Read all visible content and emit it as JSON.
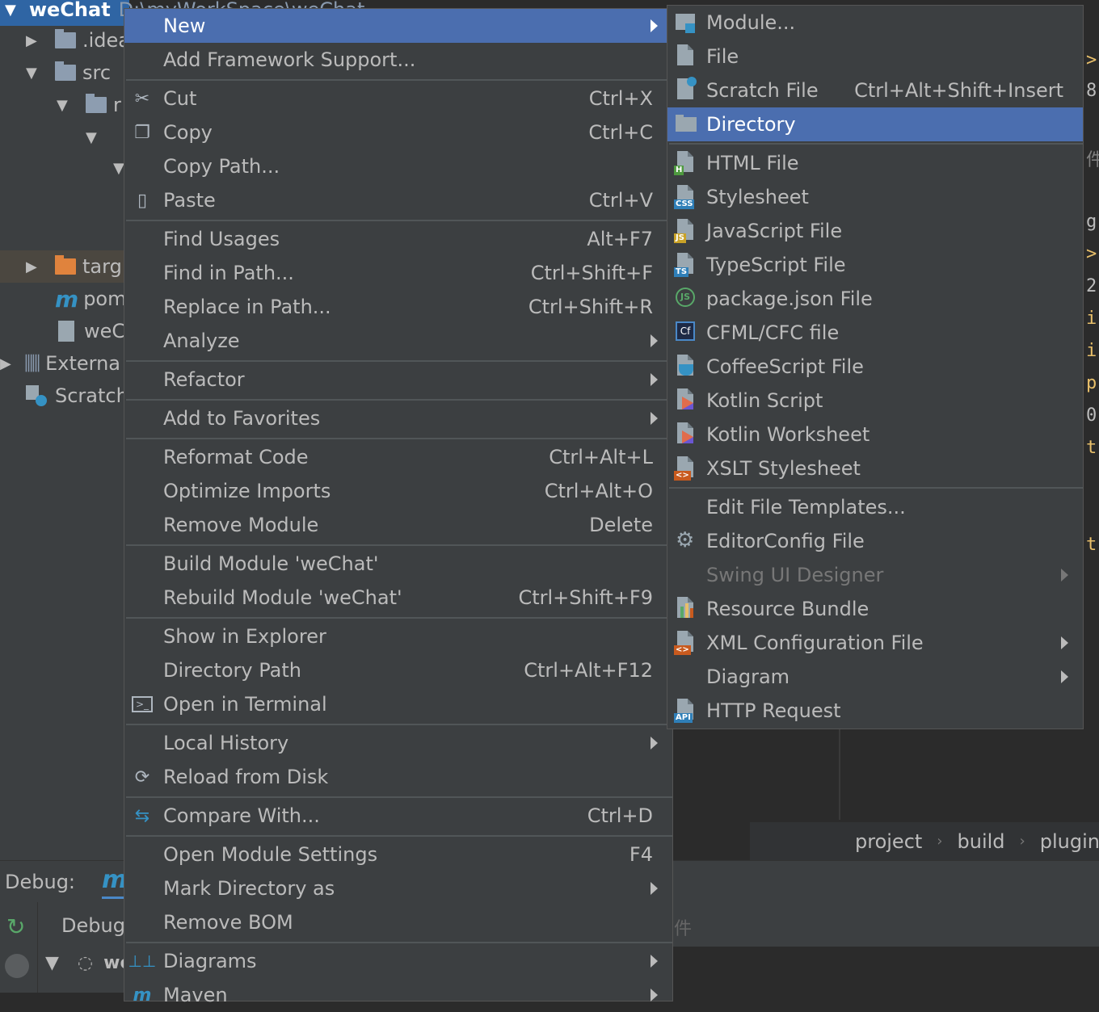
{
  "project_tree": {
    "root_name": "weChat",
    "root_path": "D:\\myWorkSpace\\weChat",
    "items": [
      {
        "label": ".idea"
      },
      {
        "label": "src"
      },
      {
        "label": "r"
      },
      {
        "label": "targ"
      },
      {
        "label": "pom"
      },
      {
        "label": "weC"
      },
      {
        "label": "Externa"
      },
      {
        "label": "Scratch"
      }
    ]
  },
  "editor": {
    "code_fragments": [
      ">",
      "8",
      "件",
      "g",
      ">",
      "2",
      "i",
      "i",
      "p",
      "0",
      "t",
      "t"
    ]
  },
  "breadcrumb": [
    "project",
    "build",
    "plugin"
  ],
  "debug": {
    "label": "Debug:",
    "config_icon": "m",
    "tab": "Debugg",
    "tree_label": "we",
    "side_text": "件"
  },
  "context_menu": {
    "items": [
      {
        "label": "New",
        "shortcut": "",
        "submenu": true,
        "icon": ""
      },
      {
        "label": "Add Framework Support...",
        "shortcut": "",
        "submenu": false,
        "icon": ""
      },
      {
        "label": "Cut",
        "shortcut": "Ctrl+X",
        "submenu": false,
        "icon": "scissors-icon"
      },
      {
        "label": "Copy",
        "shortcut": "Ctrl+C",
        "submenu": false,
        "icon": "copy-icon"
      },
      {
        "label": "Copy Path...",
        "shortcut": "",
        "submenu": false,
        "icon": ""
      },
      {
        "label": "Paste",
        "shortcut": "Ctrl+V",
        "submenu": false,
        "icon": "paste-icon"
      },
      {
        "label": "Find Usages",
        "shortcut": "Alt+F7",
        "submenu": false,
        "icon": ""
      },
      {
        "label": "Find in Path...",
        "shortcut": "Ctrl+Shift+F",
        "submenu": false,
        "icon": ""
      },
      {
        "label": "Replace in Path...",
        "shortcut": "Ctrl+Shift+R",
        "submenu": false,
        "icon": ""
      },
      {
        "label": "Analyze",
        "shortcut": "",
        "submenu": true,
        "icon": ""
      },
      {
        "label": "Refactor",
        "shortcut": "",
        "submenu": true,
        "icon": ""
      },
      {
        "label": "Add to Favorites",
        "shortcut": "",
        "submenu": true,
        "icon": ""
      },
      {
        "label": "Reformat Code",
        "shortcut": "Ctrl+Alt+L",
        "submenu": false,
        "icon": ""
      },
      {
        "label": "Optimize Imports",
        "shortcut": "Ctrl+Alt+O",
        "submenu": false,
        "icon": ""
      },
      {
        "label": "Remove Module",
        "shortcut": "Delete",
        "submenu": false,
        "icon": ""
      },
      {
        "label": "Build Module 'weChat'",
        "shortcut": "",
        "submenu": false,
        "icon": ""
      },
      {
        "label": "Rebuild Module 'weChat'",
        "shortcut": "Ctrl+Shift+F9",
        "submenu": false,
        "icon": ""
      },
      {
        "label": "Show in Explorer",
        "shortcut": "",
        "submenu": false,
        "icon": ""
      },
      {
        "label": "Directory Path",
        "shortcut": "Ctrl+Alt+F12",
        "submenu": false,
        "icon": ""
      },
      {
        "label": "Open in Terminal",
        "shortcut": "",
        "submenu": false,
        "icon": "terminal-icon"
      },
      {
        "label": "Local History",
        "shortcut": "",
        "submenu": true,
        "icon": ""
      },
      {
        "label": "Reload from Disk",
        "shortcut": "",
        "submenu": false,
        "icon": "reload-icon"
      },
      {
        "label": "Compare With...",
        "shortcut": "Ctrl+D",
        "submenu": false,
        "icon": "compare-icon"
      },
      {
        "label": "Open Module Settings",
        "shortcut": "F4",
        "submenu": false,
        "icon": ""
      },
      {
        "label": "Mark Directory as",
        "shortcut": "",
        "submenu": true,
        "icon": ""
      },
      {
        "label": "Remove BOM",
        "shortcut": "",
        "submenu": false,
        "icon": ""
      },
      {
        "label": "Diagrams",
        "shortcut": "",
        "submenu": true,
        "icon": "diagram-icon"
      },
      {
        "label": "Maven",
        "shortcut": "",
        "submenu": true,
        "icon": "maven-icon"
      }
    ]
  },
  "new_submenu": {
    "items": [
      {
        "label": "Module...",
        "shortcut": "",
        "submenu": false,
        "icon": "module-icon"
      },
      {
        "label": "File",
        "shortcut": "",
        "submenu": false,
        "icon": "file-icon"
      },
      {
        "label": "Scratch File",
        "shortcut": "Ctrl+Alt+Shift+Insert",
        "submenu": false,
        "icon": "scratch-file-icon"
      },
      {
        "label": "Directory",
        "shortcut": "",
        "submenu": false,
        "icon": "directory-icon"
      },
      {
        "label": "HTML File",
        "shortcut": "",
        "submenu": false,
        "icon": "html-file-icon",
        "badge": "H",
        "badge_color": "#4e9a3f"
      },
      {
        "label": "Stylesheet",
        "shortcut": "",
        "submenu": false,
        "icon": "css-file-icon",
        "badge": "CSS",
        "badge_color": "#2f7fb8"
      },
      {
        "label": "JavaScript File",
        "shortcut": "",
        "submenu": false,
        "icon": "js-file-icon",
        "badge": "JS",
        "badge_color": "#c9a227"
      },
      {
        "label": "TypeScript File",
        "shortcut": "",
        "submenu": false,
        "icon": "ts-file-icon",
        "badge": "TS",
        "badge_color": "#2f7fb8"
      },
      {
        "label": "package.json File",
        "shortcut": "",
        "submenu": false,
        "icon": "nodejs-icon"
      },
      {
        "label": "CFML/CFC file",
        "shortcut": "",
        "submenu": false,
        "icon": "cfml-icon"
      },
      {
        "label": "CoffeeScript File",
        "shortcut": "",
        "submenu": false,
        "icon": "coffeescript-icon"
      },
      {
        "label": "Kotlin Script",
        "shortcut": "",
        "submenu": false,
        "icon": "kotlin-icon"
      },
      {
        "label": "Kotlin Worksheet",
        "shortcut": "",
        "submenu": false,
        "icon": "kotlin-icon"
      },
      {
        "label": "XSLT Stylesheet",
        "shortcut": "",
        "submenu": false,
        "icon": "xslt-file-icon",
        "badge": "<>",
        "badge_color": "#c85a1e"
      },
      {
        "label": "Edit File Templates...",
        "shortcut": "",
        "submenu": false,
        "icon": ""
      },
      {
        "label": "EditorConfig File",
        "shortcut": "",
        "submenu": false,
        "icon": "gear-icon"
      },
      {
        "label": "Swing UI Designer",
        "shortcut": "",
        "submenu": true,
        "icon": ""
      },
      {
        "label": "Resource Bundle",
        "shortcut": "",
        "submenu": false,
        "icon": "resource-bundle-icon"
      },
      {
        "label": "XML Configuration File",
        "shortcut": "",
        "submenu": true,
        "icon": "xml-file-icon",
        "badge": "<>",
        "badge_color": "#c85a1e"
      },
      {
        "label": "Diagram",
        "shortcut": "",
        "submenu": true,
        "icon": ""
      },
      {
        "label": "HTTP Request",
        "shortcut": "",
        "submenu": false,
        "icon": "api-file-icon",
        "badge": "API",
        "badge_color": "#2f7fb8"
      }
    ]
  },
  "colors": {
    "selection": "#4b6eaf",
    "menu_bg": "#3c3f41",
    "text": "#bbbbbb"
  }
}
